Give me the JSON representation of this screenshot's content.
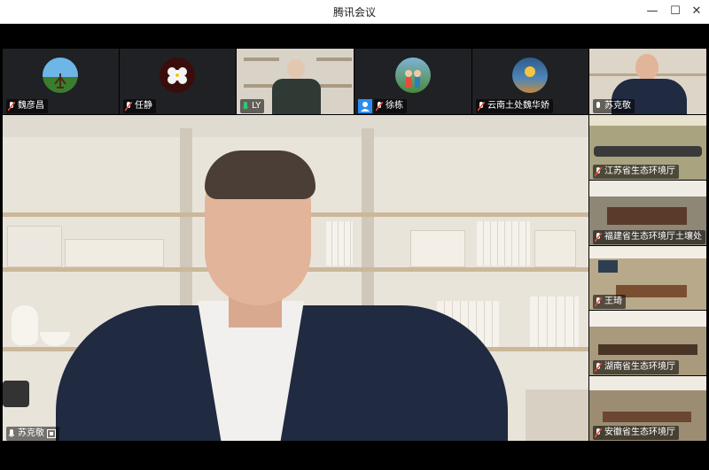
{
  "window": {
    "title": "腾讯会议"
  },
  "top_row": [
    {
      "name": "魏彦昌",
      "avatar": "landscape-avatar-icon"
    },
    {
      "name": "任静",
      "avatar": "flower-avatar-icon"
    },
    {
      "name": "LY",
      "avatar": "video"
    },
    {
      "name": "徐栋",
      "avatar": "family-avatar-icon"
    },
    {
      "name": "云南土处魏华娇",
      "avatar": "sunset-avatar-icon"
    }
  ],
  "side_column": [
    {
      "name": "苏克敬"
    },
    {
      "name": "江苏省生态环境厅"
    },
    {
      "name": "福建省生态环境厅土壤处"
    },
    {
      "name": "王琦"
    },
    {
      "name": "湖南省生态环境厅"
    },
    {
      "name": "安徽省生态环境厅"
    }
  ],
  "main": {
    "speaker": "苏克敬"
  },
  "colors": {
    "accent_mic": "#2ecc71",
    "muted_mic": "#e74c3c"
  }
}
